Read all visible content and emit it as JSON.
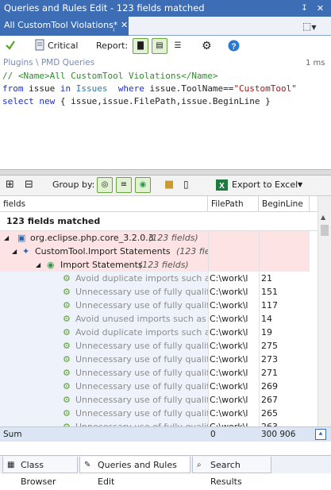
{
  "window": {
    "title": "Queries and Rules Edit  -  123 fields matched"
  },
  "doc_tab": {
    "label": "All CustomTool Violations*"
  },
  "toolbar": {
    "critical_label": "Critical",
    "report_label": "Report:"
  },
  "breadcrumb": {
    "text": "Plugins \\ PMD Queries",
    "elapsed": "1 ms"
  },
  "code": {
    "line1_comment": "// <Name>All CustomTool Violations</Name>",
    "line2": {
      "from": "from",
      "issue1": " issue ",
      "in": "in",
      "issues": " Issues ",
      "where": " where",
      "rest": " issue.ToolName==",
      "str": "\"CustomTool\""
    },
    "line3": {
      "select": "select",
      "new": " new",
      "rest": " { issue,issue.FilePath,issue.BeginLine }"
    }
  },
  "toolbar2": {
    "group_by_label": "Group by:",
    "export_label": "Export to Excel"
  },
  "columns": [
    "fields",
    "FilePath",
    "BeginLine"
  ],
  "summary": "123 fields matched",
  "tree": [
    {
      "level": 0,
      "label": "org.eclipse.php.core_3.2.0.3",
      "count": "(123 fields)"
    },
    {
      "level": 1,
      "label": "CustomTool.Import Statements",
      "count": "(123 fiel"
    },
    {
      "level": 2,
      "label": "Import Statements",
      "count": "(123 fields)"
    }
  ],
  "items": [
    {
      "text": "Avoid duplicate imports such as 'c",
      "path": "C:\\work\\l",
      "line": "21"
    },
    {
      "text": "Unnecessary use of fully qualified",
      "path": "C:\\work\\l",
      "line": "151"
    },
    {
      "text": "Unnecessary use of fully qualified",
      "path": "C:\\work\\l",
      "line": "117"
    },
    {
      "text": "Avoid unused imports such as 'jav",
      "path": "C:\\work\\l",
      "line": "14"
    },
    {
      "text": "Avoid duplicate imports such as 'c",
      "path": "C:\\work\\l",
      "line": "19"
    },
    {
      "text": "Unnecessary use of fully qualified",
      "path": "C:\\work\\l",
      "line": "275"
    },
    {
      "text": "Unnecessary use of fully qualified",
      "path": "C:\\work\\l",
      "line": "273"
    },
    {
      "text": "Unnecessary use of fully qualified",
      "path": "C:\\work\\l",
      "line": "271"
    },
    {
      "text": "Unnecessary use of fully qualified",
      "path": "C:\\work\\l",
      "line": "269"
    },
    {
      "text": "Unnecessary use of fully qualified",
      "path": "C:\\work\\l",
      "line": "267"
    },
    {
      "text": "Unnecessary use of fully qualified",
      "path": "C:\\work\\l",
      "line": "265"
    },
    {
      "text": "Unnecessary use of fully qualified",
      "path": "C:\\work\\l",
      "line": "263"
    }
  ],
  "sum_row": {
    "label": "Sum",
    "path": "0",
    "line": "300 906"
  },
  "bottom_tabs": [
    "Class Browser",
    "Queries and Rules Edit",
    "Search Results"
  ],
  "colors": {
    "accent": "#3d6db5",
    "group_row": "#fde3e3",
    "item_row": "#eef3fb",
    "sum_bar": "#dbe5f3"
  }
}
